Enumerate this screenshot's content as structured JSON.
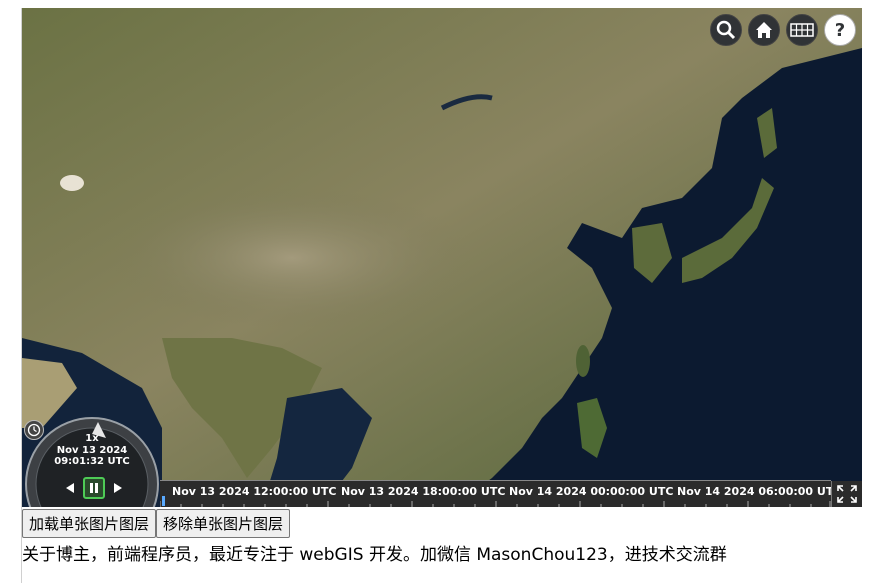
{
  "toolbar": {
    "buttons": [
      {
        "icon": "search-icon"
      },
      {
        "icon": "home-icon"
      },
      {
        "icon": "grid-icon"
      },
      {
        "icon": "help-icon"
      }
    ]
  },
  "animation": {
    "speed": "1x",
    "date": "Nov 13 2024",
    "time": "09:01:32 UTC"
  },
  "timeline": {
    "labels": [
      "Nov 13 2024 12:00:00 UTC",
      "Nov 13 2024 18:00:00 UTC",
      "Nov 14 2024 00:00:00 UTC",
      "Nov 14 2024 06:00:00 UTC"
    ]
  },
  "buttons": {
    "load": "加载单张图片图层",
    "remove": "移除单张图片图层"
  },
  "footer": "关于博主，前端程序员，最近专注于 webGIS 开发。加微信 MasonChou123，进技术交流群",
  "colors": {
    "ocean": "#0c1a30",
    "land": "#5e6a3c",
    "widget": "#303336"
  }
}
